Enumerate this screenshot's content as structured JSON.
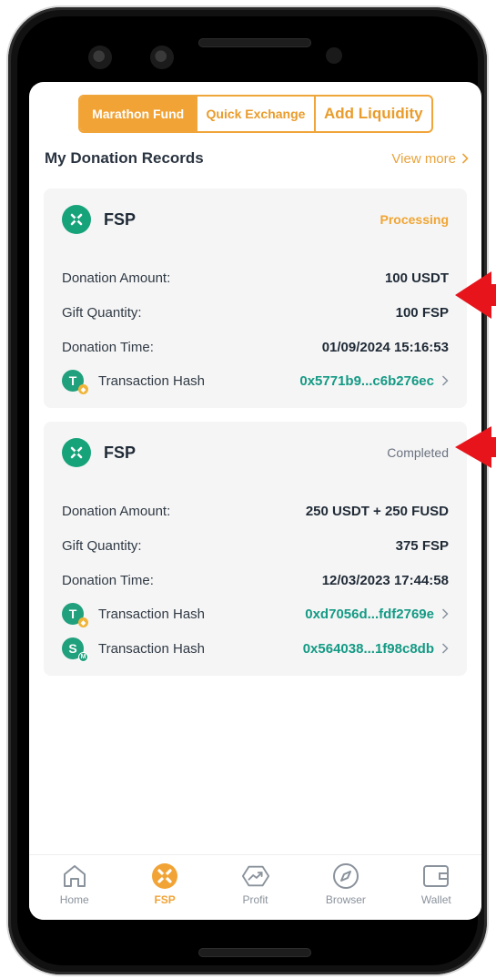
{
  "tabs": [
    {
      "label": "Marathon Fund",
      "active": true
    },
    {
      "label": "Quick Exchange",
      "active": false
    },
    {
      "label": "Add Liquidity",
      "active": false
    }
  ],
  "section": {
    "title": "My Donation Records",
    "view_more": "View more"
  },
  "records": [
    {
      "token": "FSP",
      "status": "Processing",
      "donation_amount_label": "Donation Amount:",
      "donation_amount": "100 USDT",
      "gift_quantity_label": "Gift Quantity:",
      "gift_quantity": "100 FSP",
      "donation_time_label": "Donation Time:",
      "donation_time": "01/09/2024 15:16:53",
      "hashes": [
        {
          "label": "Transaction Hash",
          "value": "0x5771b9...c6b276ec",
          "coin": "T"
        }
      ]
    },
    {
      "token": "FSP",
      "status": "Completed",
      "donation_amount_label": "Donation Amount:",
      "donation_amount": "250 USDT + 250 FUSD",
      "gift_quantity_label": "Gift Quantity:",
      "gift_quantity": "375 FSP",
      "donation_time_label": "Donation Time:",
      "donation_time": "12/03/2023 17:44:58",
      "hashes": [
        {
          "label": "Transaction Hash",
          "value": "0xd7056d...fdf2769e",
          "coin": "T"
        },
        {
          "label": "Transaction Hash",
          "value": "0x564038...1f98c8db",
          "coin": "S"
        }
      ]
    }
  ],
  "bottom_nav": [
    {
      "label": "Home",
      "icon": "home-icon",
      "active": false
    },
    {
      "label": "FSP",
      "icon": "fsp-icon",
      "active": true
    },
    {
      "label": "Profit",
      "icon": "profit-icon",
      "active": false
    },
    {
      "label": "Browser",
      "icon": "compass-icon",
      "active": false
    },
    {
      "label": "Wallet",
      "icon": "wallet-icon",
      "active": false
    }
  ],
  "colors": {
    "accent": "#f1a336",
    "teal": "#149a85",
    "arrow": "#e8141b"
  }
}
